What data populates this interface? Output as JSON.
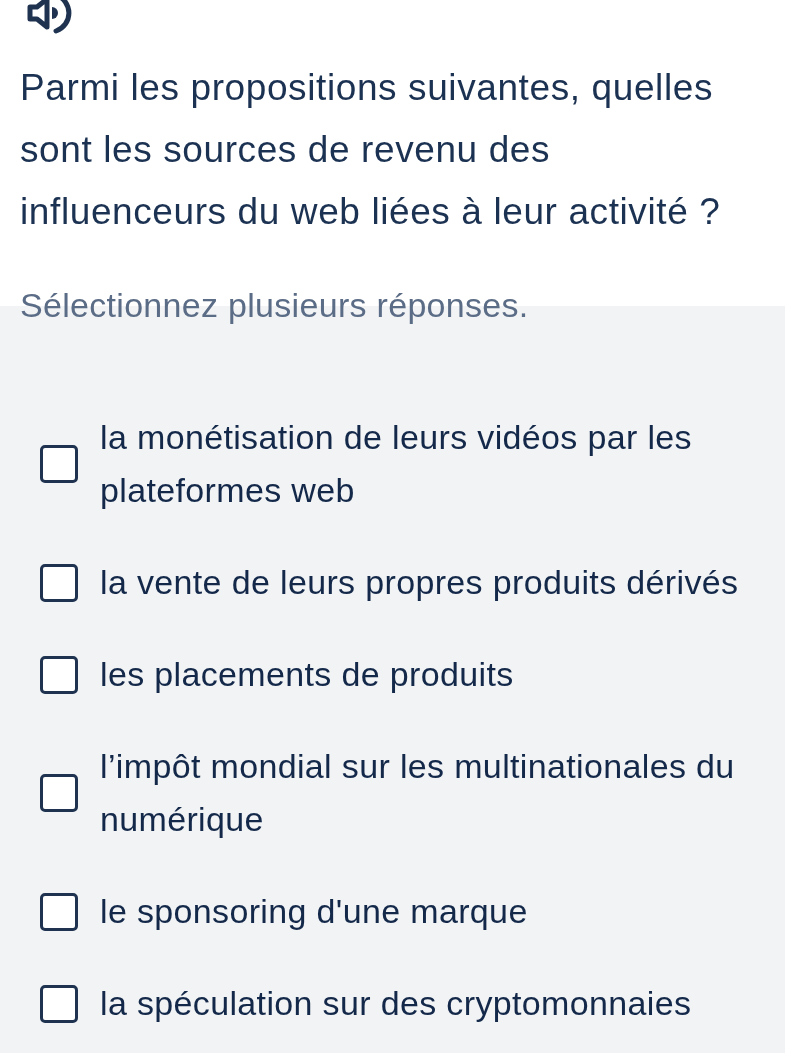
{
  "question": "Parmi les propositions suivantes, quelles sont les sources de revenu des influenceurs du web liées à leur activité ?",
  "instruction": "Sélectionnez plusieurs réponses.",
  "options": [
    {
      "label": "la monétisation de leurs vidéos par les plateformes web",
      "checked": false
    },
    {
      "label": "la vente de leurs propres produits dérivés",
      "checked": false
    },
    {
      "label": "les placements de produits",
      "checked": false
    },
    {
      "label": "l’impôt mondial sur les multinationales du numérique",
      "checked": false
    },
    {
      "label": "le sponsoring d'une marque",
      "checked": false
    },
    {
      "label": "la spéculation sur des cryptomonnaies",
      "checked": false
    }
  ]
}
